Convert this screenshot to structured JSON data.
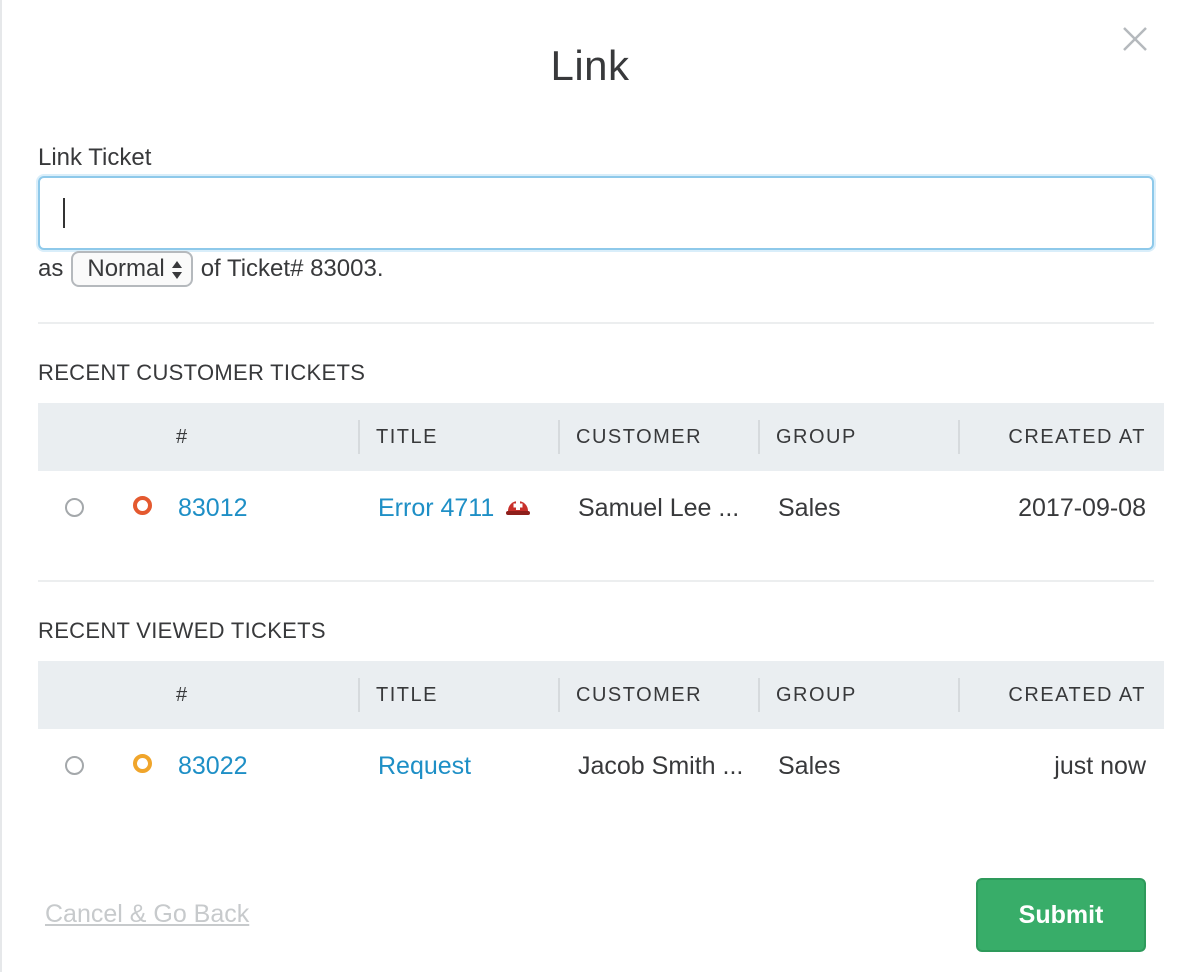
{
  "modal": {
    "title": "Link",
    "close_icon": "close-icon"
  },
  "form": {
    "label": "Link Ticket",
    "input_value": "",
    "as_text": "as",
    "link_type": "Normal",
    "of_text": "of Ticket# 83003."
  },
  "columns": [
    "#",
    "TITLE",
    "CUSTOMER",
    "GROUP",
    "CREATED AT"
  ],
  "customer_tickets": {
    "title": "RECENT CUSTOMER TICKETS",
    "rows": [
      {
        "number": "83012",
        "title": "Error 4711",
        "customer": "Samuel Lee ...",
        "group": "Sales",
        "created_at": "2017-09-08",
        "status_color": "#e4592f",
        "escalation_icon": "escalation-icon"
      }
    ]
  },
  "viewed_tickets": {
    "title": "RECENT VIEWED TICKETS",
    "rows": [
      {
        "number": "83022",
        "title": "Request",
        "customer": "Jacob Smith ...",
        "group": "Sales",
        "created_at": "just now",
        "status_color": "#f0a52b"
      }
    ]
  },
  "footer": {
    "cancel_label": "Cancel & Go Back",
    "submit_label": "Submit"
  },
  "colors": {
    "accent_link": "#1e8fc6",
    "submit_green": "#38ad69",
    "header_bg": "#eaeef1"
  }
}
